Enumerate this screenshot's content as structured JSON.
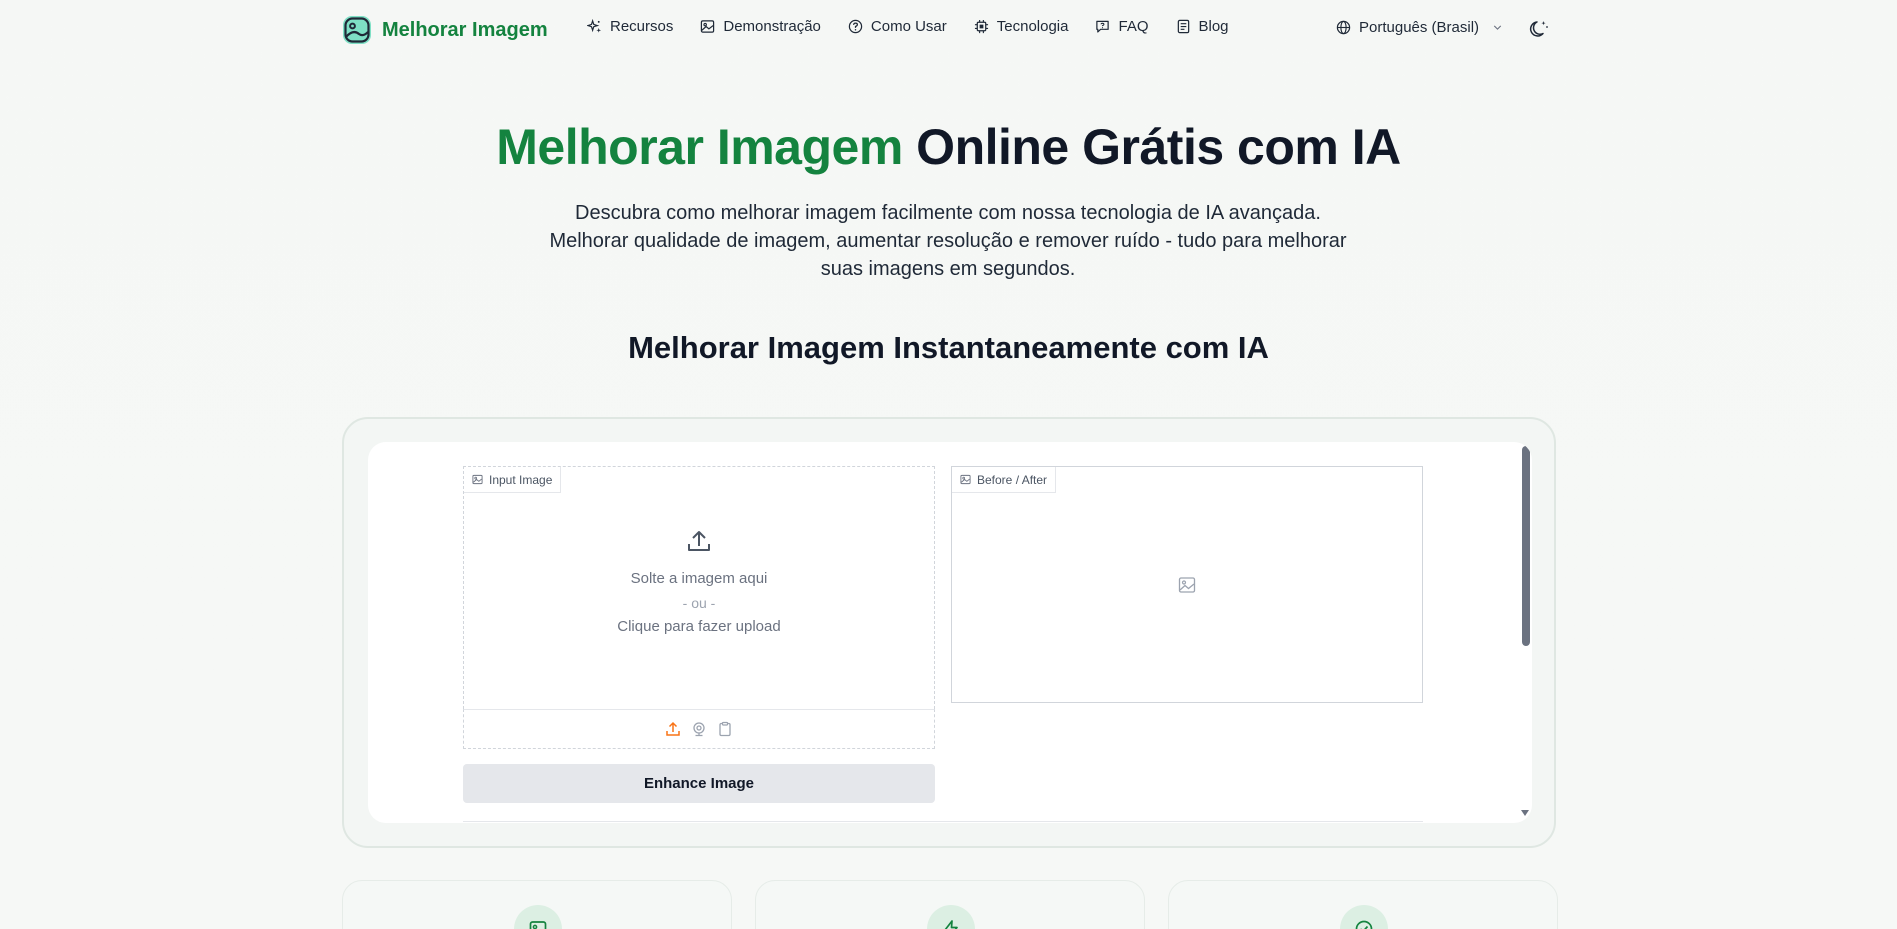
{
  "nav": {
    "brand": "Melhorar Imagem",
    "links": [
      {
        "label": "Recursos",
        "icon": "sparkles-icon"
      },
      {
        "label": "Demonstração",
        "icon": "image-icon"
      },
      {
        "label": "Como Usar",
        "icon": "help-circle-icon"
      },
      {
        "label": "Tecnologia",
        "icon": "cpu-icon"
      },
      {
        "label": "FAQ",
        "icon": "message-icon"
      },
      {
        "label": "Blog",
        "icon": "document-icon"
      }
    ],
    "language": "Português (Brasil)"
  },
  "hero": {
    "title_accent": "Melhorar Imagem",
    "title_rest": " Online Grátis com IA",
    "subtitle": "Descubra como melhorar imagem facilmente com nossa tecnologia de IA avançada. Melhorar qualidade de imagem, aumentar resolução e remover ruído - tudo para melhorar suas imagens em segundos."
  },
  "tool": {
    "section_title": "Melhorar Imagem Instantaneamente com IA",
    "input_label": "Input Image",
    "output_label": "Before / After",
    "drop_text": "Solte a imagem aqui",
    "drop_or": "- ou -",
    "click_text": "Clique para fazer upload",
    "enhance_button": "Enhance Image"
  },
  "colors": {
    "brand_green": "#14833f",
    "upload_orange": "#f97316"
  }
}
